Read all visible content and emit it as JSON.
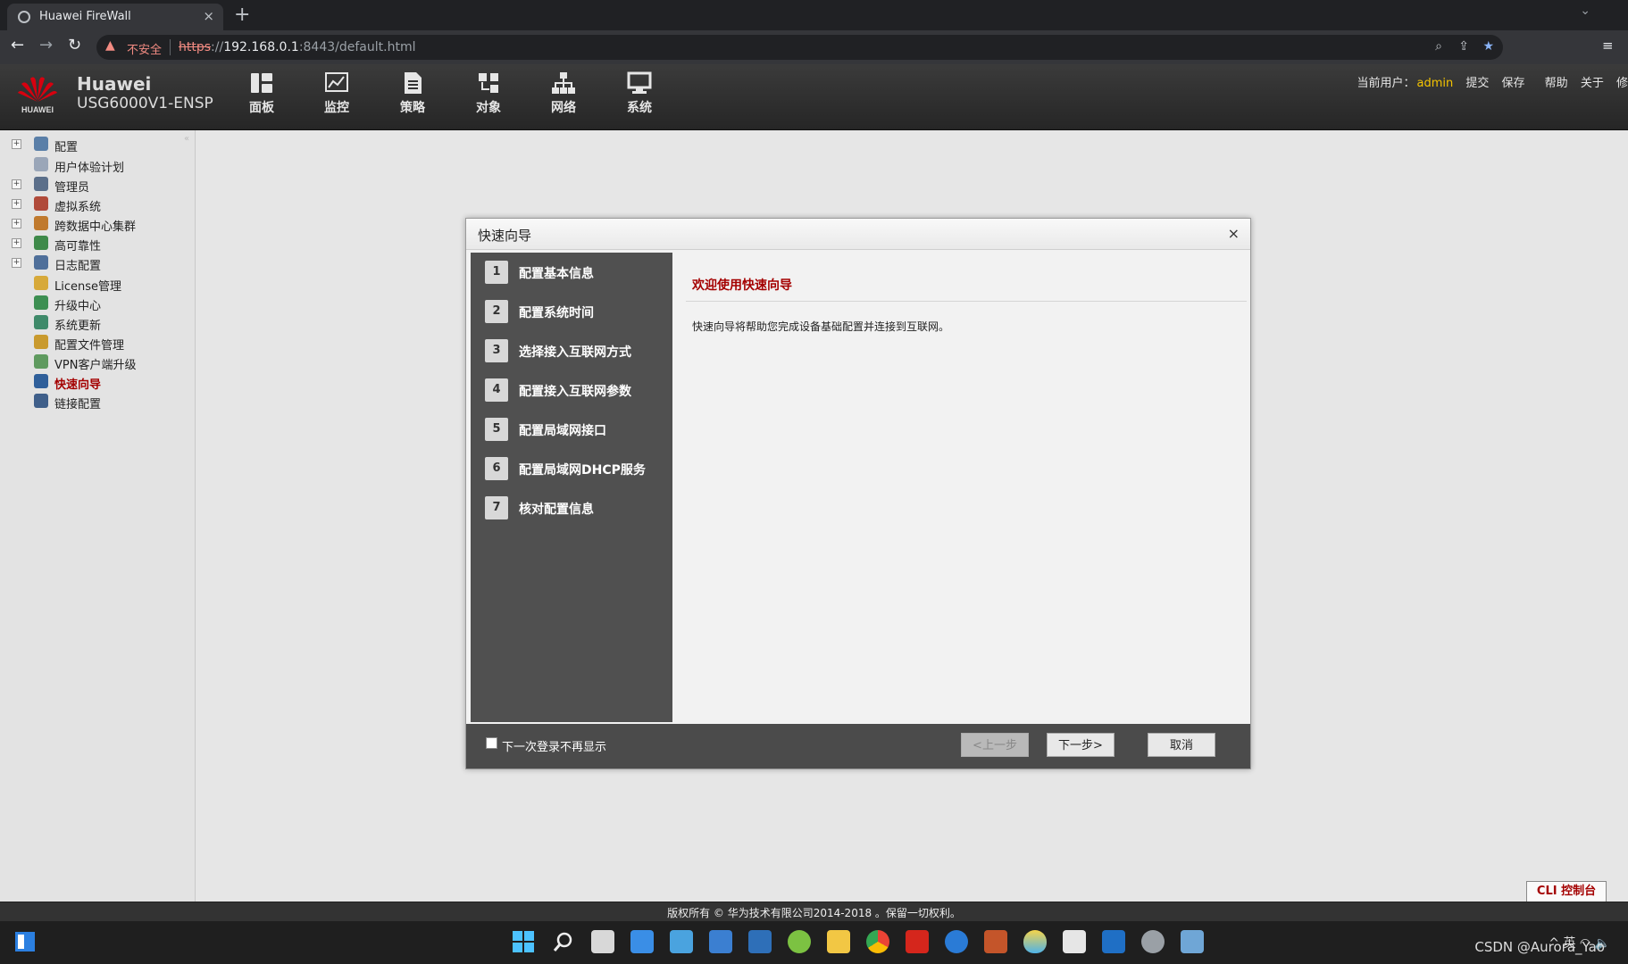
{
  "browser": {
    "tab_title": "Huawei FireWall",
    "new_tab": "+",
    "tab_close": "×",
    "insecure_label": "不安全",
    "url_scheme": "https",
    "url_sep": "://",
    "url_host": "192.168.0.1",
    "url_rest": ":8443/default.html"
  },
  "header": {
    "brand": "Huawei",
    "model": "USG6000V1-ENSP",
    "logo_text": "HUAWEI",
    "nav": [
      {
        "label": "面板",
        "icon": "dashboard-icon"
      },
      {
        "label": "监控",
        "icon": "monitor-icon"
      },
      {
        "label": "策略",
        "icon": "policy-icon"
      },
      {
        "label": "对象",
        "icon": "object-icon"
      },
      {
        "label": "网络",
        "icon": "network-icon"
      },
      {
        "label": "系统",
        "icon": "system-icon"
      }
    ],
    "user_label": "当前用户：",
    "username": "admin",
    "links": [
      "提交",
      "保存",
      "帮助",
      "关于",
      "修"
    ]
  },
  "sidebar": {
    "items": [
      {
        "label": "配置",
        "expandable": true,
        "color": "#5a7fa8"
      },
      {
        "label": "用户体验计划",
        "expandable": false,
        "color": "#9aa6b8"
      },
      {
        "label": "管理员",
        "expandable": true,
        "color": "#5b6f8a"
      },
      {
        "label": "虚拟系统",
        "expandable": true,
        "color": "#b04a3a"
      },
      {
        "label": "跨数据中心集群",
        "expandable": true,
        "color": "#c07a2e"
      },
      {
        "label": "高可靠性",
        "expandable": true,
        "color": "#3f8a4a"
      },
      {
        "label": "日志配置",
        "expandable": true,
        "color": "#4f6f9a"
      },
      {
        "label": "License管理",
        "expandable": false,
        "color": "#d7a93a"
      },
      {
        "label": "升级中心",
        "expandable": false,
        "color": "#3d8f52"
      },
      {
        "label": "系统更新",
        "expandable": false,
        "color": "#3f8a6a"
      },
      {
        "label": "配置文件管理",
        "expandable": false,
        "color": "#c99a2e"
      },
      {
        "label": "VPN客户端升级",
        "expandable": false,
        "color": "#5f9a5f"
      },
      {
        "label": "快速向导",
        "expandable": false,
        "color": "#2f5f9a",
        "active": true
      },
      {
        "label": "链接配置",
        "expandable": false,
        "color": "#3f5f8a"
      }
    ]
  },
  "dialog": {
    "title": "快速向导",
    "close": "×",
    "steps": [
      {
        "num": "1",
        "label": "配置基本信息"
      },
      {
        "num": "2",
        "label": "配置系统时间"
      },
      {
        "num": "3",
        "label": "选择接入互联网方式"
      },
      {
        "num": "4",
        "label": "配置接入互联网参数"
      },
      {
        "num": "5",
        "label": "配置局域网接口"
      },
      {
        "num": "6",
        "label": "配置局域网DHCP服务"
      },
      {
        "num": "7",
        "label": "核对配置信息"
      }
    ],
    "welcome": "欢迎使用快速向导",
    "description": "快速向导将帮助您完成设备基础配置并连接到互联网。",
    "checkbox_label": "下一次登录不再显示",
    "checkbox_checked": false,
    "prev_label": "<上一步",
    "next_label": "下一步>",
    "cancel_label": "取消"
  },
  "footer": {
    "cli_label": "CLI 控制台",
    "copyright": "版权所有 © 华为技术有限公司2014-2018 。保留一切权利。"
  },
  "taskbar": {
    "watermark": "CSDN @Aurora_Yao",
    "tray_lang": "英"
  }
}
